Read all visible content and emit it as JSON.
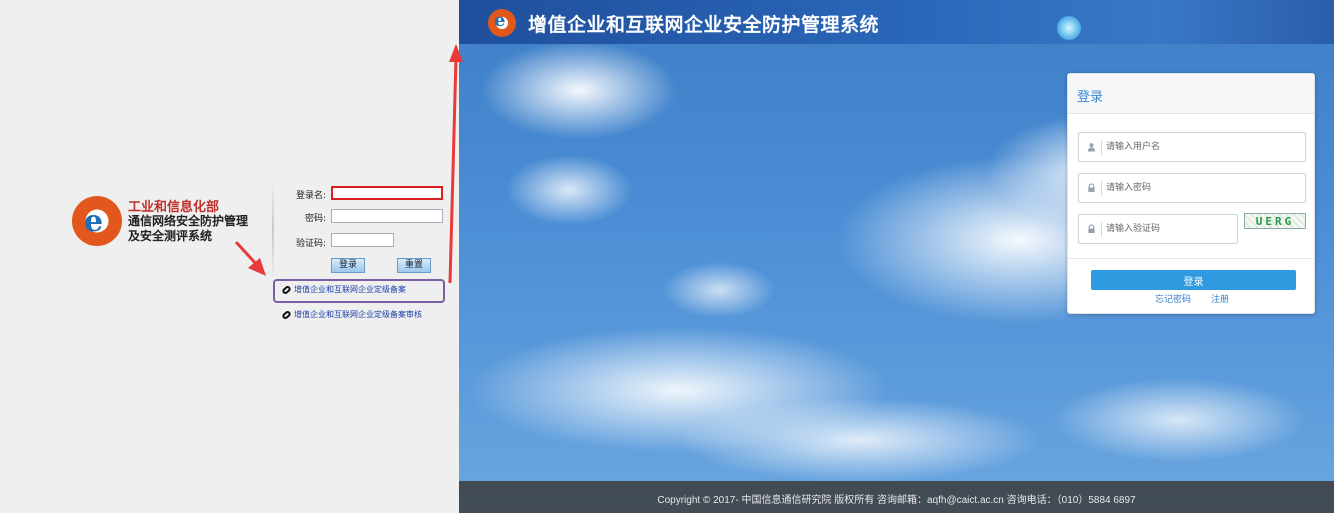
{
  "left_panel": {
    "title_line1": "工业和信息化部",
    "title_line2": "通信网络安全防护管理",
    "title_line3": "及安全测评系统",
    "username_label": "登录名:",
    "password_label": "密码:",
    "code_label": "验证码:",
    "login_button": "登录",
    "reset_button": "重置",
    "link1": "增值企业和互联网企业定级备案",
    "link2": "增值企业和互联网企业定级备案审核"
  },
  "main": {
    "header_title": "增值企业和互联网企业安全防护管理系统",
    "card_title": "登录",
    "username_placeholder": "请输入用户名",
    "password_placeholder": "请输入密码",
    "code_placeholder": "请输入验证码",
    "captcha_text": "UERG",
    "login_button": "登录",
    "forgot_link": "忘记密码",
    "register_link": "注册",
    "footer": "Copyright © 2017- 中国信息通信研究院 版权所有 咨询邮箱：aqfh@caict.ac.cn 咨询电话：（010）5884 6897"
  },
  "colors": {
    "accent": "#2f9ae0",
    "header": "#2a66b8",
    "annotation_arrow": "#e83a3a",
    "highlight_box": "#7b5ea3"
  },
  "icons": [
    "logo-gear-icon",
    "user-icon",
    "lock-icon",
    "link-icon"
  ]
}
